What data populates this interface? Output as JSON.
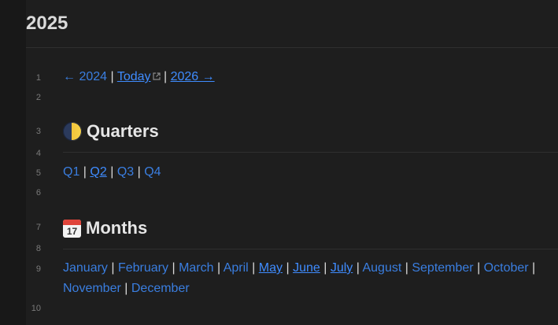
{
  "note": {
    "title": "2025"
  },
  "gutter": [
    "1",
    "2",
    "3",
    "4",
    "5",
    "6",
    "7",
    "8",
    "9",
    "10"
  ],
  "nav": {
    "prev": "← 2024",
    "today": "Today",
    "next": "2026 →",
    "separator": "|"
  },
  "quarters": {
    "heading": "Quarters",
    "items": [
      "Q1",
      "Q2",
      "Q3",
      "Q4"
    ]
  },
  "months": {
    "heading": "Months",
    "items": [
      "January",
      "February",
      "March",
      "April",
      "May",
      "June",
      "July",
      "August",
      "September",
      "October",
      "November",
      "December"
    ]
  },
  "icons": {
    "quarters": "first-quarter-moon-icon",
    "months": "calendar-icon",
    "today": "external-link-icon"
  },
  "colors": {
    "background": "#1e1e1e",
    "link": "#3a7ee0",
    "link_resolved": "#3f8cff",
    "text": "#dadada"
  },
  "calendar_badge": "17"
}
